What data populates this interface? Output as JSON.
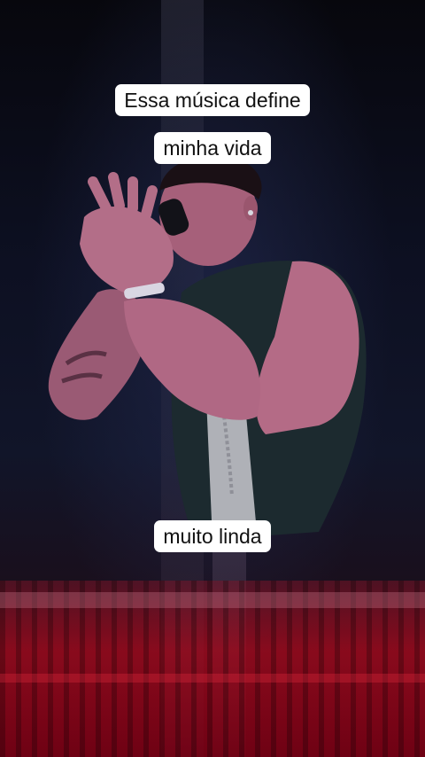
{
  "captions": {
    "top_line_1": "Essa música define",
    "top_line_2": "minha vida",
    "bottom": "muito linda"
  }
}
